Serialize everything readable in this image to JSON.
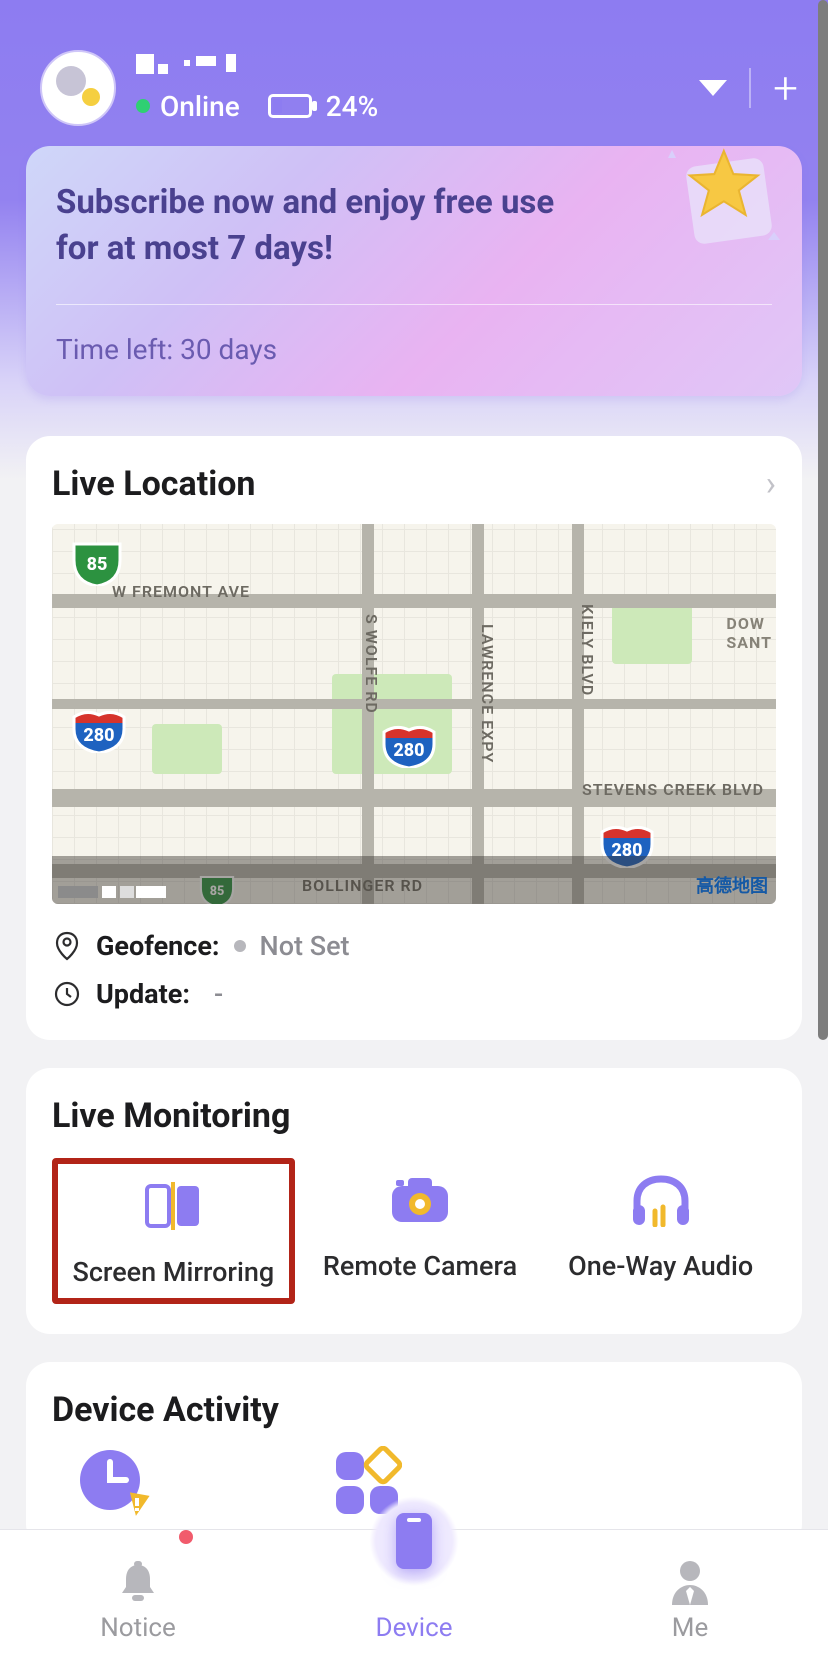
{
  "header": {
    "status_label": "Online",
    "battery_pct": "24%"
  },
  "promo": {
    "title": "Subscribe now and enjoy free use for at most 7 days!",
    "time_left": "Time left: 30 days"
  },
  "location": {
    "title": "Live Location",
    "geofence_label": "Geofence:",
    "geofence_value": "Not Set",
    "update_label": "Update:",
    "update_value": "-",
    "roads": {
      "fremont": "W FREMONT AVE",
      "swolfe": "S WOLFE RD",
      "lawrence": "LAWRENCE EXPY",
      "kiely": "KIELY BLVD",
      "downtown": "DOW\nSANT",
      "stevens": "STEVENS CREEK BLVD",
      "bollinger": "BOLLINGER RD"
    },
    "highway85": "85",
    "highway280": "280",
    "watermark": "高德地图"
  },
  "monitoring": {
    "title": "Live Monitoring",
    "items": [
      {
        "label": "Screen Mirroring"
      },
      {
        "label": "Remote Camera"
      },
      {
        "label": "One-Way Audio"
      }
    ]
  },
  "activity": {
    "title": "Device Activity"
  },
  "tabs": {
    "notice": "Notice",
    "device": "Device",
    "me": "Me"
  }
}
